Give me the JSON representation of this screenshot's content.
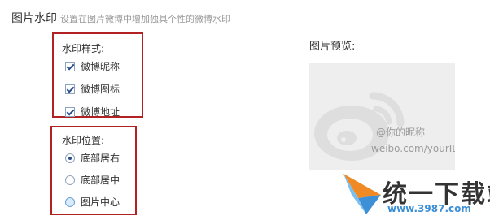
{
  "header": {
    "title": "图片水印",
    "description": "设置在图片微博中增加独具个性的微博水印"
  },
  "watermark_style": {
    "label": "水印样式:",
    "options": [
      {
        "label": "微博昵称",
        "checked": true
      },
      {
        "label": "微博图标",
        "checked": true
      },
      {
        "label": "微博地址",
        "checked": true
      }
    ]
  },
  "watermark_position": {
    "label": "水印位置:",
    "options": [
      {
        "label": "底部居右",
        "selected": true
      },
      {
        "label": "底部居中",
        "selected": false
      },
      {
        "label": "图片中心",
        "selected": false
      }
    ]
  },
  "preview": {
    "label": "图片预览:",
    "watermark_name": "@你的昵称",
    "watermark_url": "weibo.com/yourID"
  },
  "site_logo": {
    "name": "统一下载站",
    "url": "www.3987.com"
  },
  "colors": {
    "highlight_border": "#b22222",
    "preview_bg": "#eeeeee",
    "logo_blue": "#3d8fd6",
    "logo_orange": "#f08a24"
  }
}
